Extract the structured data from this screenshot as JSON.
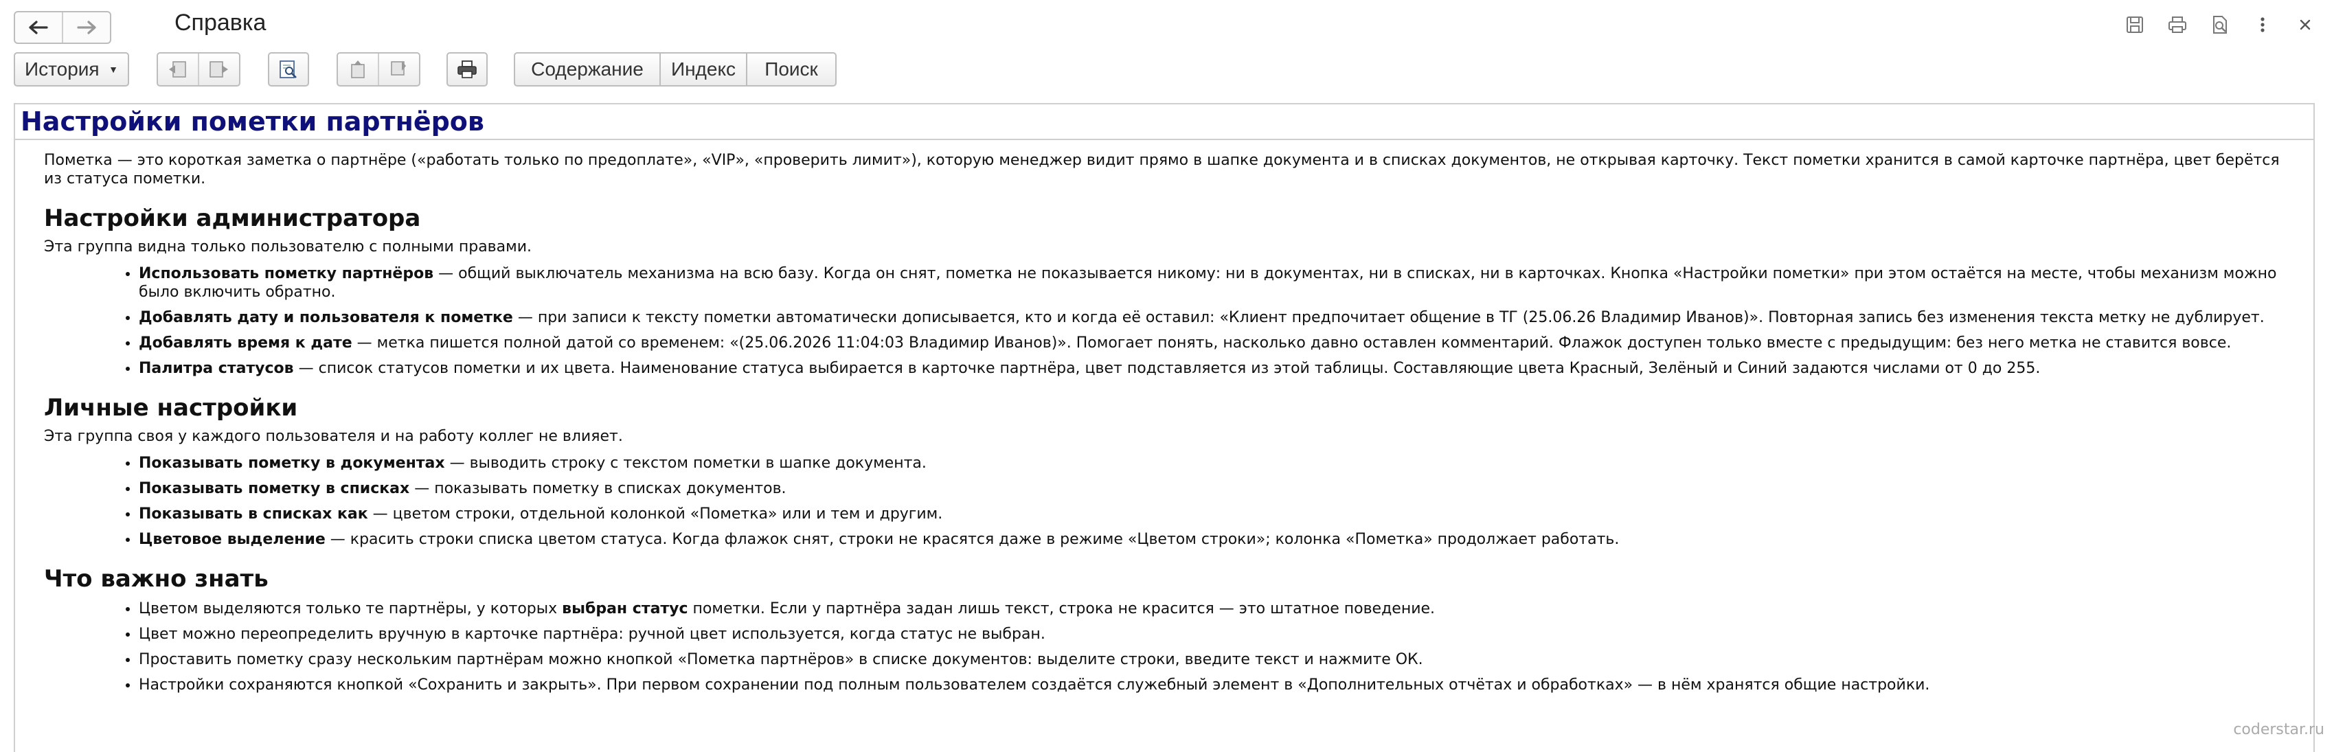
{
  "window": {
    "title": "Справка",
    "watermark": "coderstar.ru"
  },
  "toolbar": {
    "history_label": "История",
    "tabs": [
      {
        "label": "Содержание"
      },
      {
        "label": "Индекс"
      },
      {
        "label": "Поиск"
      }
    ]
  },
  "doc": {
    "title": "Настройки пометки партнёров",
    "intro": "Пометка — это короткая заметка о партнёре («работать только по предоплате», «VIP», «проверить лимит»), которую менеджер видит прямо в шапке документа и в списках документов, не открывая карточку. Текст пометки хранится в самой карточке партнёра, цвет берётся из статуса пометки.",
    "sections": [
      {
        "heading": "Настройки администратора",
        "desc": "Эта группа видна только пользователю с полными правами.",
        "items": [
          {
            "bold": "Использовать пометку партнёров",
            "text": " — общий выключатель механизма на всю базу. Когда он снят, пометка не показывается никому: ни в документах, ни в списках, ни в карточках. Кнопка «Настройки пометки» при этом остаётся на месте, чтобы механизм можно было включить обратно."
          },
          {
            "bold": "Добавлять дату и пользователя к пометке",
            "text": " — при записи к тексту пометки автоматически дописывается, кто и когда её оставил: «Клиент предпочитает общение в ТГ (25.06.26 Владимир Иванов)». Повторная запись без изменения текста метку не дублирует."
          },
          {
            "bold": "Добавлять время к дате",
            "text": " — метка пишется полной датой со временем: «(25.06.2026 11:04:03 Владимир Иванов)». Помогает понять, насколько давно оставлен комментарий. Флажок доступен только вместе с предыдущим: без него метка не ставится вовсе."
          },
          {
            "bold": "Палитра статусов",
            "text": " — список статусов пометки и их цвета. Наименование статуса выбирается в карточке партнёра, цвет подставляется из этой таблицы. Составляющие цвета Красный, Зелёный и Синий задаются числами от 0 до 255."
          }
        ]
      },
      {
        "heading": "Личные настройки",
        "desc": "Эта группа своя у каждого пользователя и на работу коллег не влияет.",
        "items": [
          {
            "bold": "Показывать пометку в документах",
            "text": " — выводить строку с текстом пометки в шапке документа."
          },
          {
            "bold": "Показывать пометку в списках",
            "text": " — показывать пометку в списках документов."
          },
          {
            "bold": "Показывать в списках как",
            "text": " — цветом строки, отдельной колонкой «Пометка» или и тем и другим."
          },
          {
            "bold": "Цветовое выделение",
            "text": " — красить строки списка цветом статуса. Когда флажок снят, строки не красятся даже в режиме «Цветом строки»; колонка «Пометка» продолжает работать."
          }
        ]
      },
      {
        "heading": "Что важно знать",
        "desc": "",
        "items": [
          {
            "pre": "Цветом выделяются только те партнёры, у которых ",
            "bold": "выбран статус",
            "text": " пометки. Если у партнёра задан лишь текст, строка не красится — это штатное поведение."
          },
          {
            "pre": "Цвет можно переопределить вручную в карточке партнёра: ручной цвет используется, когда статус не выбран.",
            "bold": "",
            "text": ""
          },
          {
            "pre": "Проставить пометку сразу нескольким партнёрам можно кнопкой «Пометка партнёров» в списке документов: выделите строки, введите текст и нажмите ОК.",
            "bold": "",
            "text": ""
          },
          {
            "pre": "Настройки сохраняются кнопкой «Сохранить и закрыть». При первом сохранении под полным пользователем создаётся служебный элемент в «Дополнительных отчётах и обработках» — в нём хранятся общие настройки.",
            "bold": "",
            "text": ""
          }
        ]
      }
    ]
  }
}
